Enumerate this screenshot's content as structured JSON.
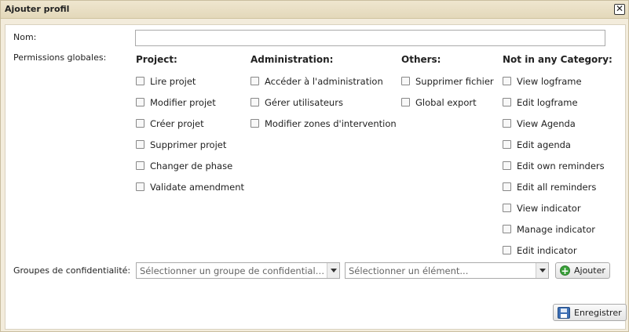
{
  "window": {
    "title": "Ajouter profil",
    "close_symbol": "✕"
  },
  "form": {
    "name_label": "Nom:",
    "name_value": "",
    "permissions_label": "Permissions globales:",
    "confidentiality_label": "Groupes de confidentialité:"
  },
  "columns": [
    {
      "heading": "Project:",
      "items": [
        "Lire projet",
        "Modifier projet",
        "Créer projet",
        "Supprimer projet",
        "Changer de phase",
        "Validate amendment"
      ]
    },
    {
      "heading": "Administration:",
      "items": [
        "Accéder à l'administration",
        "Gérer utilisateurs",
        "Modifier zones d'intervention"
      ]
    },
    {
      "heading": "Others:",
      "items": [
        "Supprimer fichier",
        "Global export"
      ]
    },
    {
      "heading": "Not in any Category:",
      "items": [
        "View logframe",
        "Edit logframe",
        "View Agenda",
        "Edit agenda",
        "Edit own reminders",
        "Edit all reminders",
        "View indicator",
        "Manage indicator",
        "Edit indicator"
      ]
    }
  ],
  "selects": {
    "group_placeholder": "Sélectionner un groupe de confidentialité...",
    "element_placeholder": "Sélectionner un élément..."
  },
  "buttons": {
    "add_label": "Ajouter",
    "save_label": "Enregistrer"
  },
  "icons": {
    "add": "plus-icon",
    "save": "save-icon",
    "close": "close-icon"
  }
}
